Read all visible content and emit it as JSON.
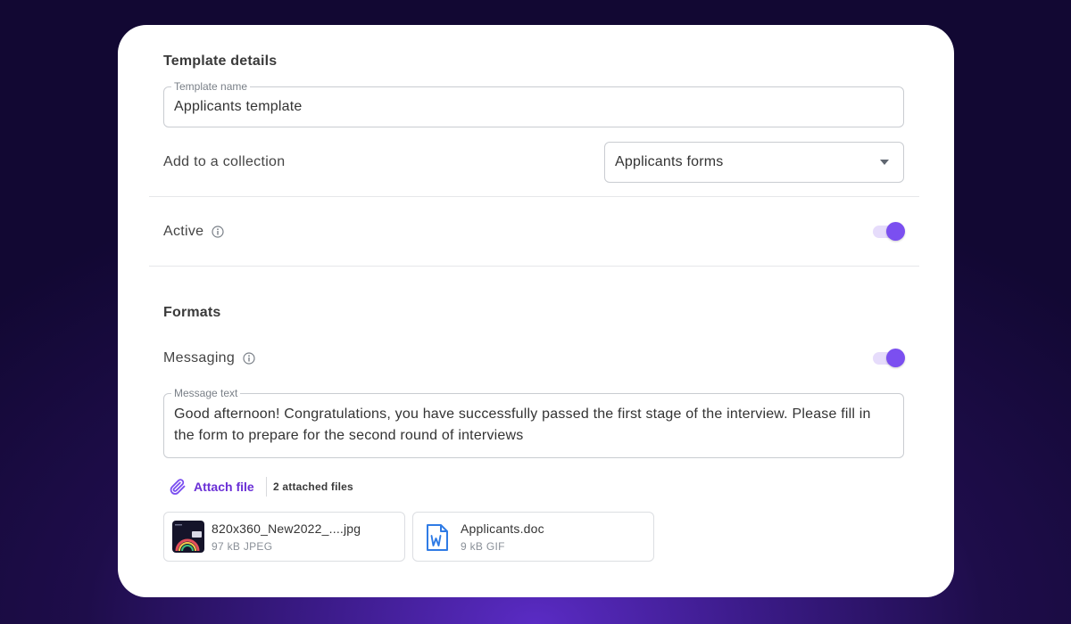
{
  "template_details": {
    "title": "Template details",
    "name_field": {
      "label": "Template name",
      "value": "Applicants template"
    },
    "collection": {
      "label": "Add to a collection",
      "selected": "Applicants forms"
    }
  },
  "active": {
    "label": "Active",
    "enabled": true
  },
  "formats": {
    "title": "Formats",
    "messaging": {
      "label": "Messaging",
      "enabled": true
    },
    "message_field": {
      "label": "Message text",
      "value": "Good afternoon! Congratulations, you have successfully passed the first stage of the interview. Please fill in the form to prepare for the second round of interviews"
    },
    "attach": {
      "button_label": "Attach file",
      "count_text": "2 attached files"
    },
    "files": [
      {
        "name": "820x360_New2022_....jpg",
        "meta": "97 kB JPEG",
        "icon": "image-thumbnail"
      },
      {
        "name": "Applicants.doc",
        "meta": "9 kB GIF",
        "icon": "word-document-icon"
      }
    ]
  },
  "colors": {
    "accent": "#7b4ff0",
    "link": "#6a2fd6",
    "background": "#1e0d4a"
  }
}
